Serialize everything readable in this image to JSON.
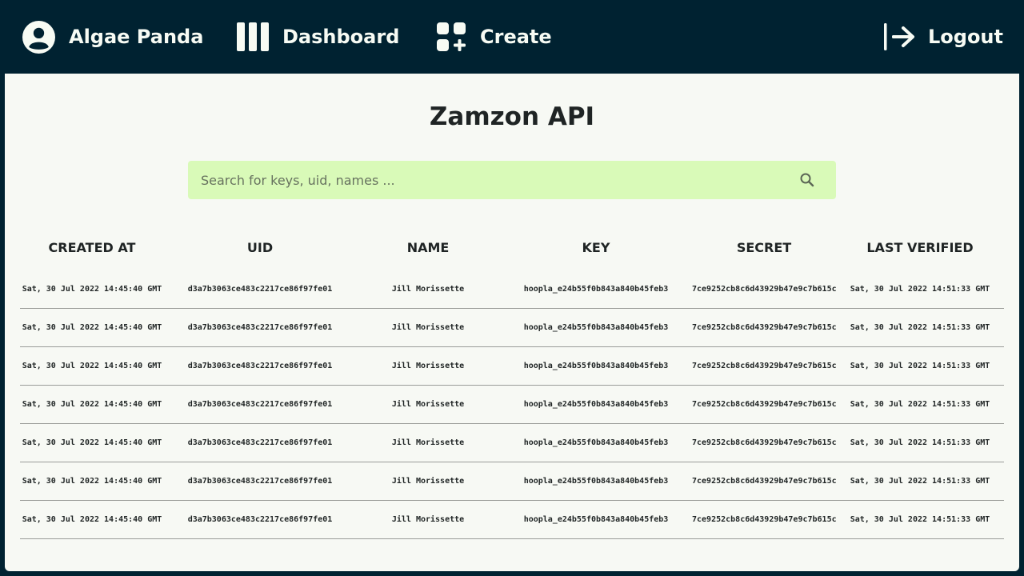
{
  "nav": {
    "user": {
      "label": "Algae Panda",
      "icon": "user-circle-icon"
    },
    "dashboard": {
      "label": "Dashboard",
      "icon": "columns-icon"
    },
    "create": {
      "label": "Create",
      "icon": "grid-plus-icon"
    },
    "logout": {
      "label": "Logout",
      "icon": "logout-arrow-icon"
    }
  },
  "page": {
    "title": "Zamzon API"
  },
  "search": {
    "placeholder": "Search for keys, uid, names ...",
    "value": ""
  },
  "colors": {
    "nav_bg": "#002231",
    "page_bg": "#f7f9f4",
    "search_bg": "#d9fab8",
    "text": "#1f2424"
  },
  "table": {
    "headers": [
      "CREATED AT",
      "UID",
      "NAME",
      "KEY",
      "SECRET",
      "LAST VERIFIED"
    ],
    "rows": [
      [
        "Sat, 30 Jul 2022 14:45:40 GMT",
        "d3a7b3063ce483c2217ce86f97fe01",
        "Jill Morissette",
        "hoopla_e24b55f0b843a840b45feb3",
        "7ce9252cb8c6d43929b47e9c7b615c",
        "Sat, 30 Jul 2022 14:51:33 GMT"
      ],
      [
        "Sat, 30 Jul 2022 14:45:40 GMT",
        "d3a7b3063ce483c2217ce86f97fe01",
        "Jill Morissette",
        "hoopla_e24b55f0b843a840b45feb3",
        "7ce9252cb8c6d43929b47e9c7b615c",
        "Sat, 30 Jul 2022 14:51:33 GMT"
      ],
      [
        "Sat, 30 Jul 2022 14:45:40 GMT",
        "d3a7b3063ce483c2217ce86f97fe01",
        "Jill Morissette",
        "hoopla_e24b55f0b843a840b45feb3",
        "7ce9252cb8c6d43929b47e9c7b615c",
        "Sat, 30 Jul 2022 14:51:33 GMT"
      ],
      [
        "Sat, 30 Jul 2022 14:45:40 GMT",
        "d3a7b3063ce483c2217ce86f97fe01",
        "Jill Morissette",
        "hoopla_e24b55f0b843a840b45feb3",
        "7ce9252cb8c6d43929b47e9c7b615c",
        "Sat, 30 Jul 2022 14:51:33 GMT"
      ],
      [
        "Sat, 30 Jul 2022 14:45:40 GMT",
        "d3a7b3063ce483c2217ce86f97fe01",
        "Jill Morissette",
        "hoopla_e24b55f0b843a840b45feb3",
        "7ce9252cb8c6d43929b47e9c7b615c",
        "Sat, 30 Jul 2022 14:51:33 GMT"
      ],
      [
        "Sat, 30 Jul 2022 14:45:40 GMT",
        "d3a7b3063ce483c2217ce86f97fe01",
        "Jill Morissette",
        "hoopla_e24b55f0b843a840b45feb3",
        "7ce9252cb8c6d43929b47e9c7b615c",
        "Sat, 30 Jul 2022 14:51:33 GMT"
      ],
      [
        "Sat, 30 Jul 2022 14:45:40 GMT",
        "d3a7b3063ce483c2217ce86f97fe01",
        "Jill Morissette",
        "hoopla_e24b55f0b843a840b45feb3",
        "7ce9252cb8c6d43929b47e9c7b615c",
        "Sat, 30 Jul 2022 14:51:33 GMT"
      ]
    ]
  }
}
